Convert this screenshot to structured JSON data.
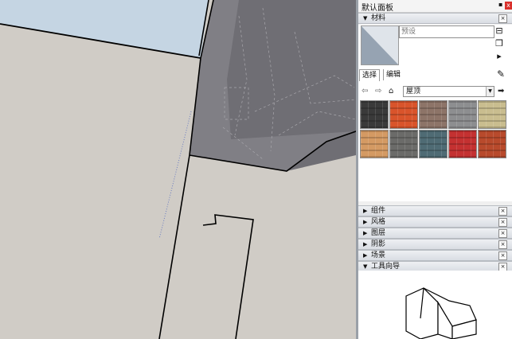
{
  "tray": {
    "title": "默认面板",
    "pin_icon": "pin-icon",
    "close_icon": "close-icon"
  },
  "materials": {
    "section_label": "材料",
    "name_placeholder": "预设",
    "tabs": [
      "选择",
      "编辑"
    ],
    "dropdown_value": "屋顶",
    "swatches": [
      {
        "name": "dark-slate-shingles",
        "color": "#3a3a3a"
      },
      {
        "name": "orange-clay-tiles",
        "color": "#d9542b"
      },
      {
        "name": "brown-shingles",
        "color": "#8d7468"
      },
      {
        "name": "grey-slate",
        "color": "#8d8e90"
      },
      {
        "name": "beige-thatch",
        "color": "#c9bd8f"
      },
      {
        "name": "tan-scallop-shingles",
        "color": "#d49a63"
      },
      {
        "name": "grey-shake",
        "color": "#6b6b69"
      },
      {
        "name": "teal-mottled",
        "color": "#4f6b74"
      },
      {
        "name": "red-metal",
        "color": "#c43131"
      },
      {
        "name": "red-spanish-tiles",
        "color": "#b84a2c"
      }
    ]
  },
  "sections": [
    {
      "label": "组件",
      "state": "collapsed"
    },
    {
      "label": "风格",
      "state": "collapsed"
    },
    {
      "label": "图层",
      "state": "collapsed"
    },
    {
      "label": "阴影",
      "state": "collapsed"
    },
    {
      "label": "场景",
      "state": "collapsed"
    },
    {
      "label": "工具向导",
      "state": "expanded"
    }
  ],
  "arrows": {
    "collapsed": "▶",
    "expanded": "▼"
  },
  "colors": {
    "sky": "#c5d5e3",
    "wall": "#d0ccc6",
    "roof": "#737278",
    "panel_bg": "#f0f0f0"
  }
}
